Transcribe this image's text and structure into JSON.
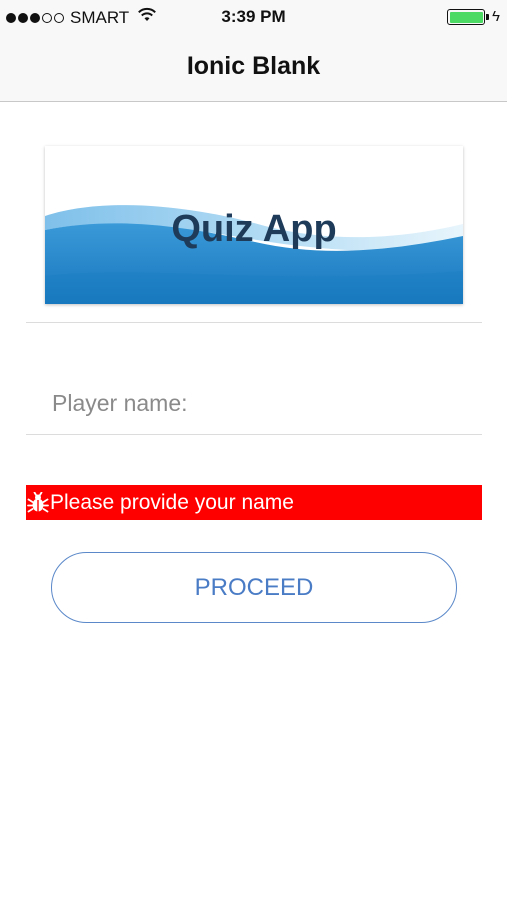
{
  "status_bar": {
    "carrier": "SMART",
    "time": "3:39 PM",
    "signal_bars_filled": 3,
    "signal_bars_total": 5,
    "battery_level": 1.0,
    "battery_color": "#4cd964",
    "icons": [
      "wifi-icon",
      "battery-icon",
      "charging-bolt-icon"
    ]
  },
  "nav": {
    "title": "Ionic Blank"
  },
  "banner": {
    "title": "Quiz App",
    "colors": {
      "wave_dark": "#1a7fc4",
      "wave_light": "#8ec8ec",
      "title": "#1f3b5a"
    }
  },
  "form": {
    "player_name": {
      "placeholder": "Player name:",
      "value": ""
    }
  },
  "error": {
    "message": "Please provide your name",
    "icon": "bug-icon",
    "color": "#ff0000"
  },
  "actions": {
    "proceed_label": "PROCEED",
    "accent": "#4a7cc6"
  }
}
